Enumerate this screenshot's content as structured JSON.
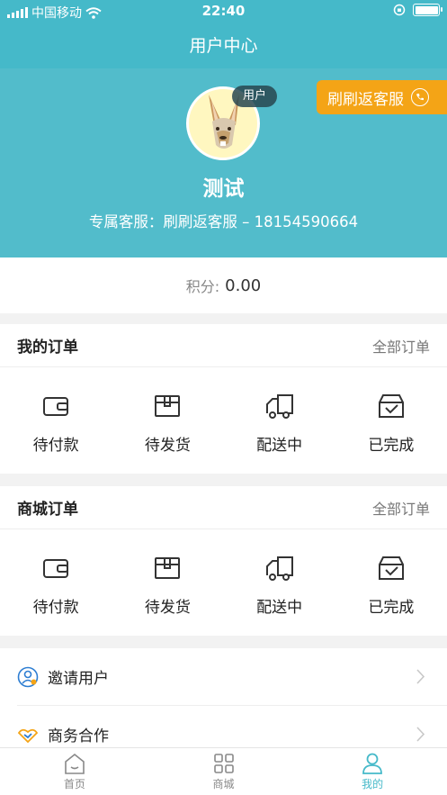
{
  "status_bar": {
    "carrier": "中国移动",
    "time": "22:40"
  },
  "nav": {
    "title": "用户中心"
  },
  "profile": {
    "role_badge": "用户",
    "service_button": "刷刷返客服",
    "username": "测试",
    "service_line": "专属客服：刷刷返客服 – 18154590664"
  },
  "points": {
    "label": "积分:",
    "value": "0.00"
  },
  "my_orders": {
    "title": "我的订单",
    "all_link": "全部订单",
    "items": [
      {
        "label": "待付款",
        "icon": "wallet-icon"
      },
      {
        "label": "待发货",
        "icon": "package-icon"
      },
      {
        "label": "配送中",
        "icon": "truck-icon"
      },
      {
        "label": "已完成",
        "icon": "completed-box-icon"
      }
    ]
  },
  "mall_orders": {
    "title": "商城订单",
    "all_link": "全部订单",
    "items": [
      {
        "label": "待付款",
        "icon": "wallet-icon"
      },
      {
        "label": "待发货",
        "icon": "package-icon"
      },
      {
        "label": "配送中",
        "icon": "truck-icon"
      },
      {
        "label": "已完成",
        "icon": "completed-box-icon"
      }
    ]
  },
  "menu": {
    "items": [
      {
        "label": "邀请用户",
        "icon": "invite-user-icon"
      },
      {
        "label": "商务合作",
        "icon": "handshake-icon"
      }
    ]
  },
  "tabs": [
    {
      "label": "首页",
      "icon": "home-icon",
      "active": false
    },
    {
      "label": "商城",
      "icon": "grid-icon",
      "active": false
    },
    {
      "label": "我的",
      "icon": "profile-icon",
      "active": true
    }
  ],
  "colors": {
    "primary": "#45b9c9",
    "accent": "#f4a416"
  }
}
